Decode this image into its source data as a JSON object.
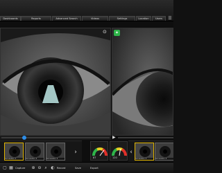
{
  "menu": {
    "items": [
      {
        "label": "Dashboards"
      },
      {
        "label": "Advanced Search"
      },
      {
        "label": "Videos"
      },
      {
        "label": "Settings"
      },
      {
        "label": "Location"
      },
      {
        "label": "Users"
      },
      {
        "label": "Reports"
      }
    ]
  },
  "panels": {
    "left": {
      "camera_icon": "camera-icon"
    },
    "right": {
      "badge_icon": "green-capture-icon"
    }
  },
  "playback": {
    "progress": 0.2
  },
  "thumbnails_left": [
    {
      "caption": "Simulation 1"
    },
    {
      "caption": "Simulation 2"
    },
    {
      "caption": "Simulation 3"
    }
  ],
  "thumbnails_right": [
    {
      "caption": "Simulation 3"
    },
    {
      "caption": "Simulation 4"
    }
  ],
  "gauges": [
    {
      "value_label": "87",
      "level": 0.7
    },
    {
      "value_label": "120",
      "level": 0.55
    }
  ],
  "toolbar": {
    "buttons": [
      {
        "label": "Capture"
      },
      {
        "label": "Record"
      },
      {
        "label": "Save"
      },
      {
        "label": "Export"
      }
    ]
  },
  "colors": {
    "accent": "#2e8de6",
    "selected": "#e0b400",
    "badge": "#2fb54a"
  }
}
